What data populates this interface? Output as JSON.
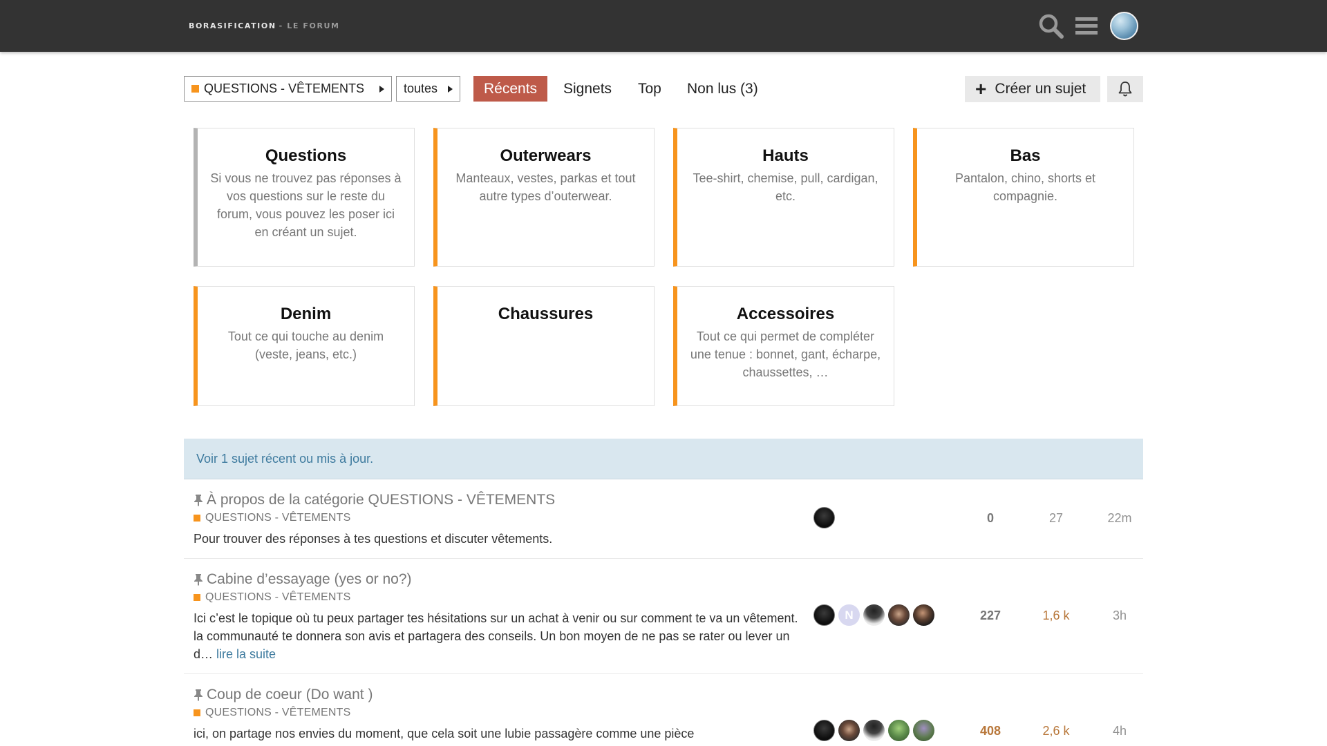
{
  "header": {
    "logo_main": "BORASIFICATION",
    "logo_sub": "- LE FORUM",
    "icons": [
      "search-icon",
      "hamburger-menu-icon",
      "user-avatar"
    ]
  },
  "nav": {
    "category_dropdown": "QUESTIONS - VÊTEMENTS",
    "subcategory_dropdown": "toutes",
    "tabs": {
      "recent": "Récents",
      "bookmarks": "Signets",
      "top": "Top",
      "unread": "Non lus (3)"
    },
    "active_tab": "recent",
    "create_topic": "Créer un sujet"
  },
  "colors": {
    "header_bg": "#333333",
    "active_tab": "#be5a49",
    "category_orange": "#f7941d",
    "category_grey": "#b3b3b3",
    "banner_bg": "#d9e7ef",
    "link": "#3d7a9e",
    "hot_stat": "#b8773a"
  },
  "categories": [
    {
      "name": "Questions",
      "description": "Si vous ne trouvez pas réponses à vos questions sur le reste du forum, vous pouvez les poser ici en créant un sujet."
    },
    {
      "name": "Outerwears",
      "description": "Manteaux, vestes, parkas et tout autre types d’outerwear."
    },
    {
      "name": "Hauts",
      "description": "Tee-shirt, chemise, pull, cardigan, etc."
    },
    {
      "name": "Bas",
      "description": "Pantalon, chino, shorts et compagnie."
    },
    {
      "name": "Denim",
      "description": "Tout ce qui touche au denim (veste, jeans, etc.)"
    },
    {
      "name": "Chaussures",
      "description": ""
    },
    {
      "name": "Accessoires",
      "description": "Tout ce qui permet de compléter une tenue : bonnet, gant, écharpe, chaussettes, …"
    }
  ],
  "banner": "Voir 1 sujet récent ou mis à jour.",
  "topics": [
    {
      "title": "À propos de la catégorie QUESTIONS - VÊTEMENTS",
      "category": "QUESTIONS - VÊTEMENTS",
      "excerpt": "Pour trouver des réponses à tes questions et discuter vêtements.",
      "read_more": "",
      "replies": "0",
      "views": "27",
      "activity": "22m"
    },
    {
      "title": "Cabine d’essayage (yes or no?)",
      "category": "QUESTIONS - VÊTEMENTS",
      "excerpt": "Ici c’est le topique où tu peux partager tes hésitations sur un achat à venir ou sur comment te va un vêtement. la communauté te donnera son avis et partagera des conseils. Un bon moyen de ne pas se rater ou lever un d…",
      "read_more": "lire la suite",
      "poster_letter": "N",
      "replies": "227",
      "views": "1,6 k",
      "activity": "3h"
    },
    {
      "title": "Coup de coeur (Do want )",
      "category": "QUESTIONS - VÊTEMENTS",
      "excerpt": "ici, on partage nos envies du moment, que cela soit une lubie passagère comme une pièce",
      "read_more": "",
      "replies": "408",
      "views": "2,6 k",
      "activity": "4h"
    }
  ]
}
